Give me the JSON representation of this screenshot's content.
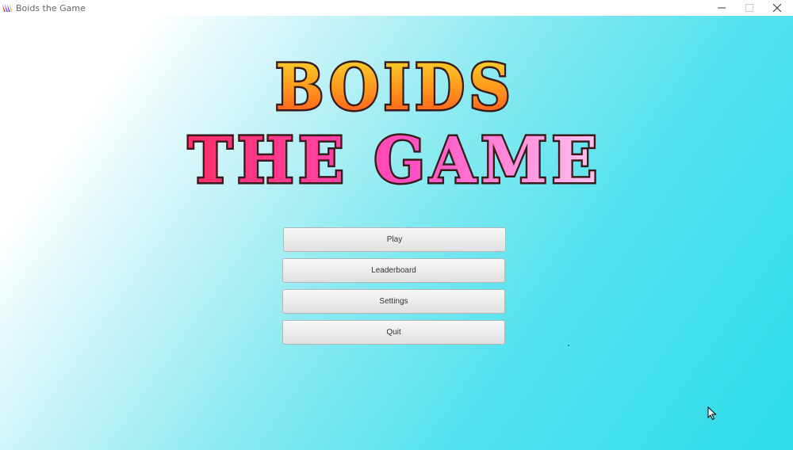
{
  "window": {
    "title": "Boids the Game",
    "icon": "boids-app-icon"
  },
  "logo": {
    "line1": "BOIDS",
    "line2": "THE GAME",
    "line1_colors": [
      "#f3e02a",
      "#ff9a1e",
      "#ff4b1a"
    ],
    "line2_colors": [
      "#ff2d6a",
      "#ff4fc4",
      "#ffc6f2"
    ]
  },
  "menu": {
    "play": "Play",
    "leaderboard": "Leaderboard",
    "settings": "Settings",
    "quit": "Quit"
  },
  "colors": {
    "background_start": "#ffffff",
    "background_end": "#2ddcea",
    "button": "#e8e8e8"
  }
}
